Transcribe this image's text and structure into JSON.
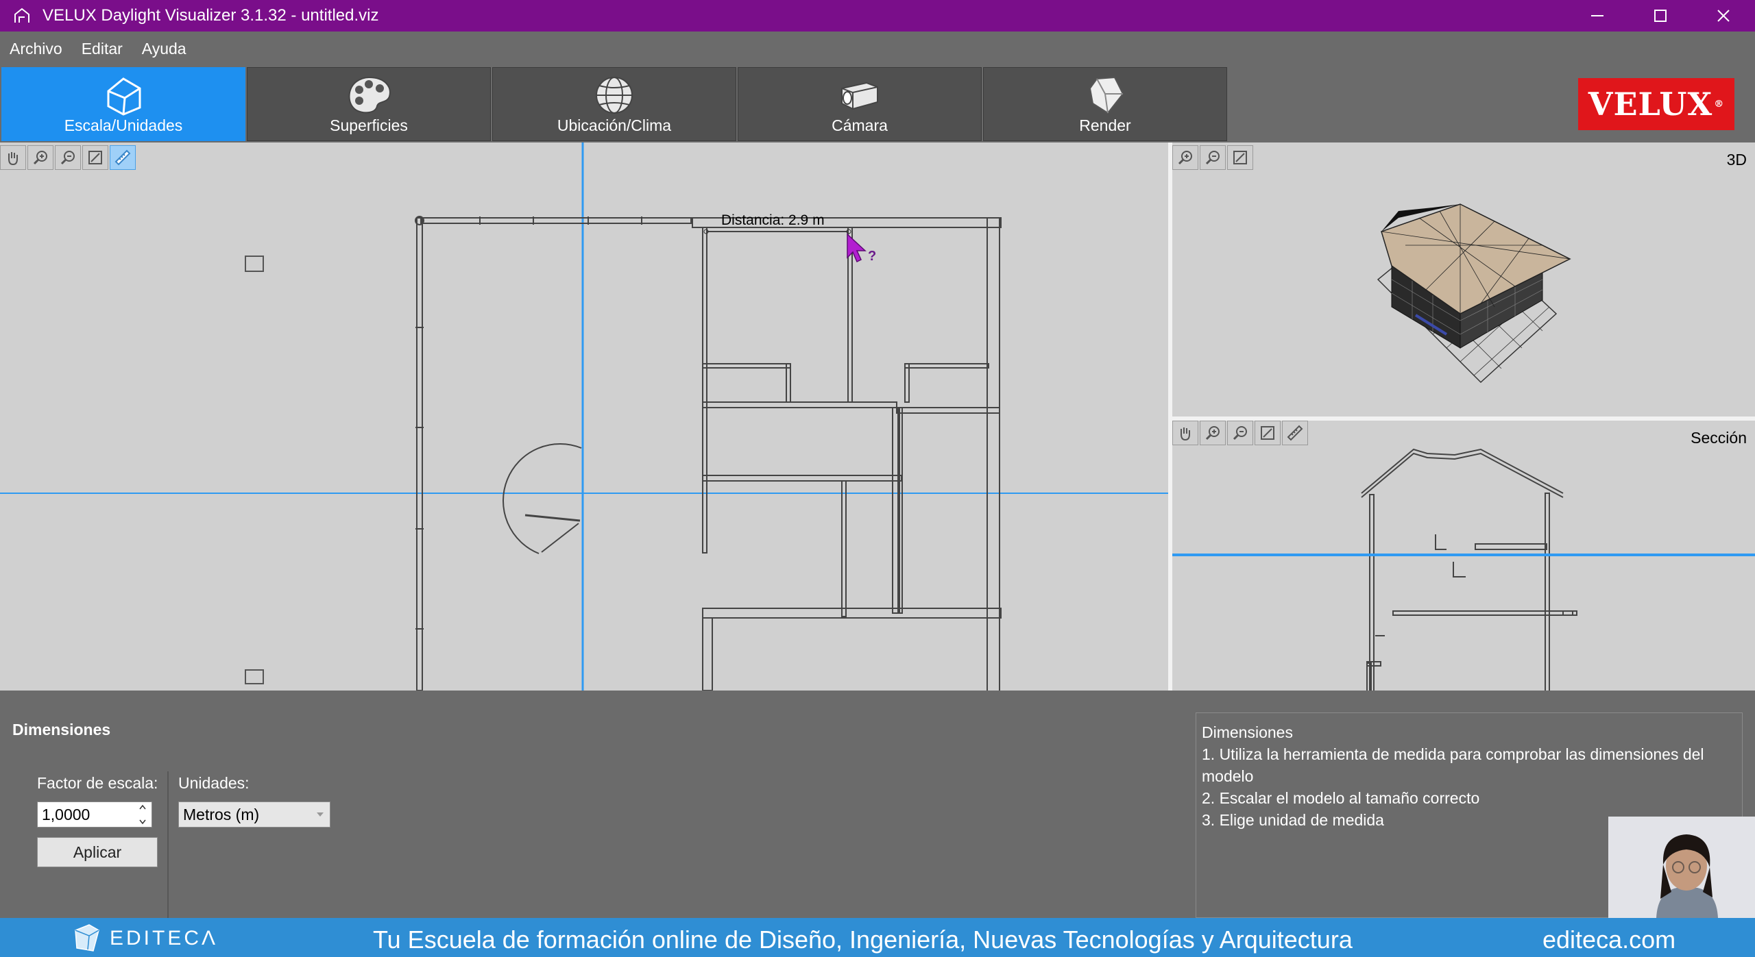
{
  "window": {
    "title": "VELUX Daylight Visualizer 3.1.32 - untitled.viz",
    "controls": [
      "minimize",
      "maximize",
      "close"
    ]
  },
  "menu": [
    "Archivo",
    "Editar",
    "Ayuda"
  ],
  "tabs": [
    {
      "label": "Escala/Unidades",
      "icon": "house-wireframe-icon",
      "active": true
    },
    {
      "label": "Superficies",
      "icon": "palette-icon",
      "active": false
    },
    {
      "label": "Ubicación/Clima",
      "icon": "globe-icon",
      "active": false
    },
    {
      "label": "Cámara",
      "icon": "camera-icon",
      "active": false
    },
    {
      "label": "Render",
      "icon": "render-icon",
      "active": false
    }
  ],
  "logo": {
    "text": "VELUX",
    "mark": "®",
    "color": "#e0161b"
  },
  "plan_view": {
    "measurement": "Distancia: 2.9 m",
    "tools": [
      "pan-icon",
      "zoom-in-icon",
      "zoom-out-icon",
      "zoom-extents-icon",
      "measure-icon"
    ],
    "active_tool": "measure-icon"
  },
  "view_3d": {
    "label": "3D"
  },
  "view_section": {
    "label": "Sección"
  },
  "bottom_panel": {
    "heading": "Dimensiones",
    "scale_label": "Factor de escala:",
    "scale_value": "1,0000",
    "units_label": "Unidades:",
    "units_value": "Metros (m)",
    "apply_label": "Aplicar"
  },
  "help": {
    "title": "Dimensiones",
    "lines": [
      "1. Utiliza la herramienta de medida para comprobar las dimensiones del modelo",
      "2. Escalar el modelo al tamaño correcto",
      "3. Elige unidad de medida"
    ]
  },
  "footer": {
    "brand": "EDITECΛ",
    "slogan": "Tu Escuela de formación online de Diseño, Ingeniería, Nuevas Tecnologías y Arquitectura",
    "site": "editeca.com"
  },
  "colors": {
    "titlebar": "#7a0e8a",
    "accent": "#1e90f0",
    "footer": "#2f8ed4",
    "panel": "#6b6b6b",
    "viewport": "#d0d0d0"
  }
}
